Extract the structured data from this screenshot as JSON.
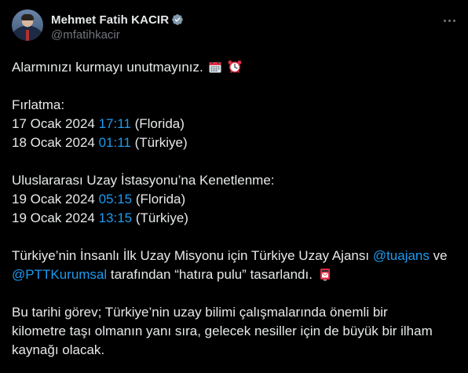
{
  "author": {
    "display_name": "Mehmet Fatih KACIR",
    "handle": "@mfatihkacir"
  },
  "colors": {
    "background": "#000000",
    "text": "#e7e9ea",
    "muted": "#71767b",
    "link": "#1d9bf0"
  },
  "tweet": {
    "line1_text": "Alarmınızı kurmayı unutmayınız.",
    "line1_emojis": [
      "calendar-icon",
      "alarm-clock-icon"
    ],
    "launch_heading": "Fırlatma:",
    "launch": [
      {
        "date": "17 Ocak 2024",
        "time": "17:11",
        "place": "(Florida)"
      },
      {
        "date": "18 Ocak 2024",
        "time": "01:11",
        "place": "(Türkiye)"
      }
    ],
    "docking_heading": "Uluslararası Uzay İstasyonu’na Kenetlenme:",
    "docking": [
      {
        "date": "19 Ocak 2024",
        "time": "05:15",
        "place": "(Florida)"
      },
      {
        "date": "19 Ocak 2024",
        "time": "13:15",
        "place": "(Türkiye)"
      }
    ],
    "stamp_para": {
      "prefix": "Türkiye’nin İnsanlı İlk Uzay Misyonu için Türkiye Uzay Ajansı",
      "mention1": "@tuajans",
      "middle": "ve",
      "mention2": "@PTTKurumsal",
      "suffix": "tarafından “hatıra pulu” tasarlandı.",
      "emoji": "postbox-icon"
    },
    "closing_para": {
      "line1": "Bu tarihi görev; Türkiye’nin uzay bilimi çalışmalarında önemli bir",
      "line2": "kilometre taşı olmanın yanı sıra, gelecek nesiller için de büyük bir ilham",
      "line3": "kaynağı olacak."
    }
  }
}
